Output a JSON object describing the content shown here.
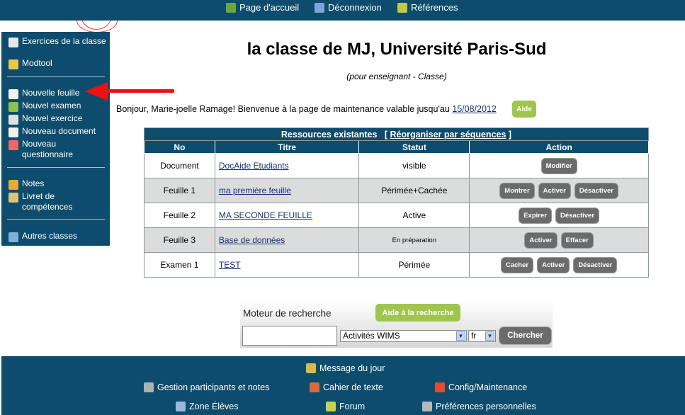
{
  "topbar": {
    "links": [
      {
        "label": "Page d'accueil",
        "icon": "home-icon",
        "color": "#6aa83c"
      },
      {
        "label": "Déconnexion",
        "icon": "logout-icon",
        "color": "#7aa6d8"
      },
      {
        "label": "Références",
        "icon": "references-icon",
        "color": "#c3c940"
      }
    ]
  },
  "sidebar": {
    "items": [
      {
        "label": "Exercices de la classe",
        "icon": "exercises-icon"
      },
      {
        "label": "Modtool",
        "icon": "modtool-icon"
      },
      {
        "label": "Nouvelle feuille",
        "icon": "new-sheet-icon"
      },
      {
        "label": "Nouvel examen",
        "icon": "new-exam-icon"
      },
      {
        "label": "Nouvel exercice",
        "icon": "new-exercise-icon"
      },
      {
        "label": "Nouveau document",
        "icon": "new-document-icon"
      },
      {
        "label": "Nouveau questionnaire",
        "icon": "new-questionnaire-icon"
      },
      {
        "label": "Notes",
        "icon": "notes-icon"
      },
      {
        "label": "Livret de compétences",
        "icon": "skills-booklet-icon"
      },
      {
        "label": "Autres classes",
        "icon": "other-classes-icon"
      }
    ]
  },
  "main": {
    "title": "la classe de MJ, Université Paris-Sud",
    "subtitle": "(pour enseignant - Classe)",
    "welcome_text": "Bonjour, Marie-joelle Ramage! Bienvenue à la page de maintenance valable jusqu'au",
    "welcome_date": "15/08/2012",
    "help_label": "Aide"
  },
  "table": {
    "caption": "Ressources existantes",
    "reorganize_label": "Réorganiser par séquences",
    "headers": [
      "No",
      "Titre",
      "Statut",
      "Action"
    ],
    "rows": [
      {
        "no": "Document",
        "title": "DocAide Etudiants",
        "status": "visible",
        "actions": [
          "Modifier"
        ]
      },
      {
        "no": "Feuille 1",
        "title": "ma première feuille",
        "status": "Périmée+Cachée",
        "actions": [
          "Montrer",
          "Activer",
          "Désactiver"
        ]
      },
      {
        "no": "Feuille 2",
        "title": "MA SECONDE FEUILLE",
        "status": "Active",
        "actions": [
          "Expirer",
          "Désactiver"
        ]
      },
      {
        "no": "Feuille 3",
        "title": "Base de données",
        "status": "En préparation",
        "actions": [
          "Activer",
          "Effacer"
        ]
      },
      {
        "no": "Examen 1",
        "title": "TEST",
        "status": "Périmée",
        "actions": [
          "Cacher",
          "Activer",
          "Désactiver"
        ]
      }
    ]
  },
  "search": {
    "label": "Moteur de recherche",
    "help_label": "Aide à la recherche",
    "input_value": "",
    "select_value": "Activités WIMS",
    "lang_value": "fr",
    "button_label": "Chercher"
  },
  "footer": {
    "message_du_jour": "Message du jour",
    "gestion": "Gestion participants et notes",
    "cahier": "Cahier de texte",
    "config": "Config/Maintenance",
    "zone": "Zone Élèves",
    "forum": "Forum",
    "prefs": "Préférences personnelles"
  }
}
